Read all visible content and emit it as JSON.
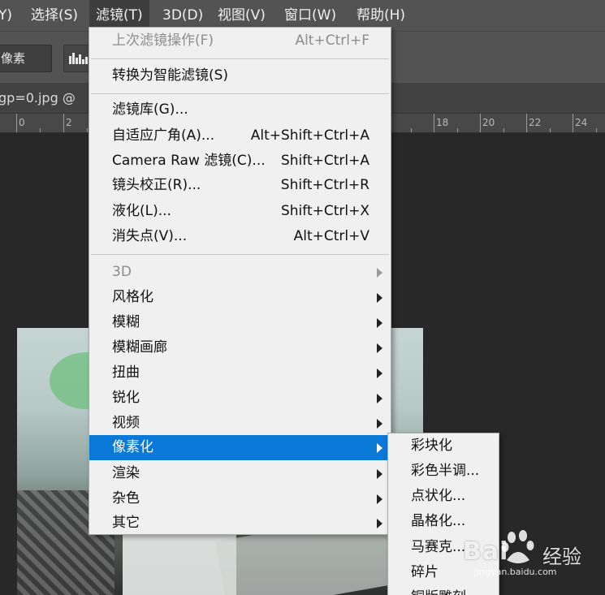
{
  "menubar": {
    "items": [
      {
        "label": "Y)"
      },
      {
        "label": "选择(S)"
      },
      {
        "label": "滤镜(T)"
      },
      {
        "label": "3D(D)"
      },
      {
        "label": "视图(V)"
      },
      {
        "label": "窗口(W)"
      },
      {
        "label": "帮助(H)"
      }
    ]
  },
  "options": {
    "field_value": "像素"
  },
  "tab": {
    "label": "gp=0.jpg @"
  },
  "ruler": {
    "numbers": [
      "0",
      "2",
      "18",
      "20",
      "22",
      "24"
    ]
  },
  "filter_menu": {
    "last_filter": {
      "label": "上次滤镜操作(F)",
      "shortcut": "Alt+Ctrl+F"
    },
    "convert_smart": {
      "label": "转换为智能滤镜(S)"
    },
    "gallery": {
      "label": "滤镜库(G)..."
    },
    "adaptive_wide": {
      "label": "自适应广角(A)...",
      "shortcut": "Alt+Shift+Ctrl+A"
    },
    "camera_raw": {
      "label": "Camera Raw 滤镜(C)...",
      "shortcut": "Shift+Ctrl+A"
    },
    "lens_correction": {
      "label": "镜头校正(R)...",
      "shortcut": "Shift+Ctrl+R"
    },
    "liquify": {
      "label": "液化(L)...",
      "shortcut": "Shift+Ctrl+X"
    },
    "vanishing_point": {
      "label": "消失点(V)...",
      "shortcut": "Alt+Ctrl+V"
    },
    "submenus": [
      {
        "label": "3D",
        "disabled": true
      },
      {
        "label": "风格化"
      },
      {
        "label": "模糊"
      },
      {
        "label": "模糊画廊"
      },
      {
        "label": "扭曲"
      },
      {
        "label": "锐化"
      },
      {
        "label": "视频"
      },
      {
        "label": "像素化",
        "highlighted": true
      },
      {
        "label": "渲染"
      },
      {
        "label": "杂色"
      },
      {
        "label": "其它"
      }
    ]
  },
  "pixelate_submenu": {
    "items": [
      "彩块化",
      "彩色半调...",
      "点状化...",
      "晶格化...",
      "马赛克...",
      "碎片",
      "铜版雕刻..."
    ]
  },
  "watermark": {
    "brand": "Bai",
    "brand_cn": "经验",
    "url": "jingyan.baidu.com"
  },
  "colors": {
    "highlight": "#0a78d7",
    "menubar": "#535353",
    "menu_bg": "#f0f0f0"
  }
}
